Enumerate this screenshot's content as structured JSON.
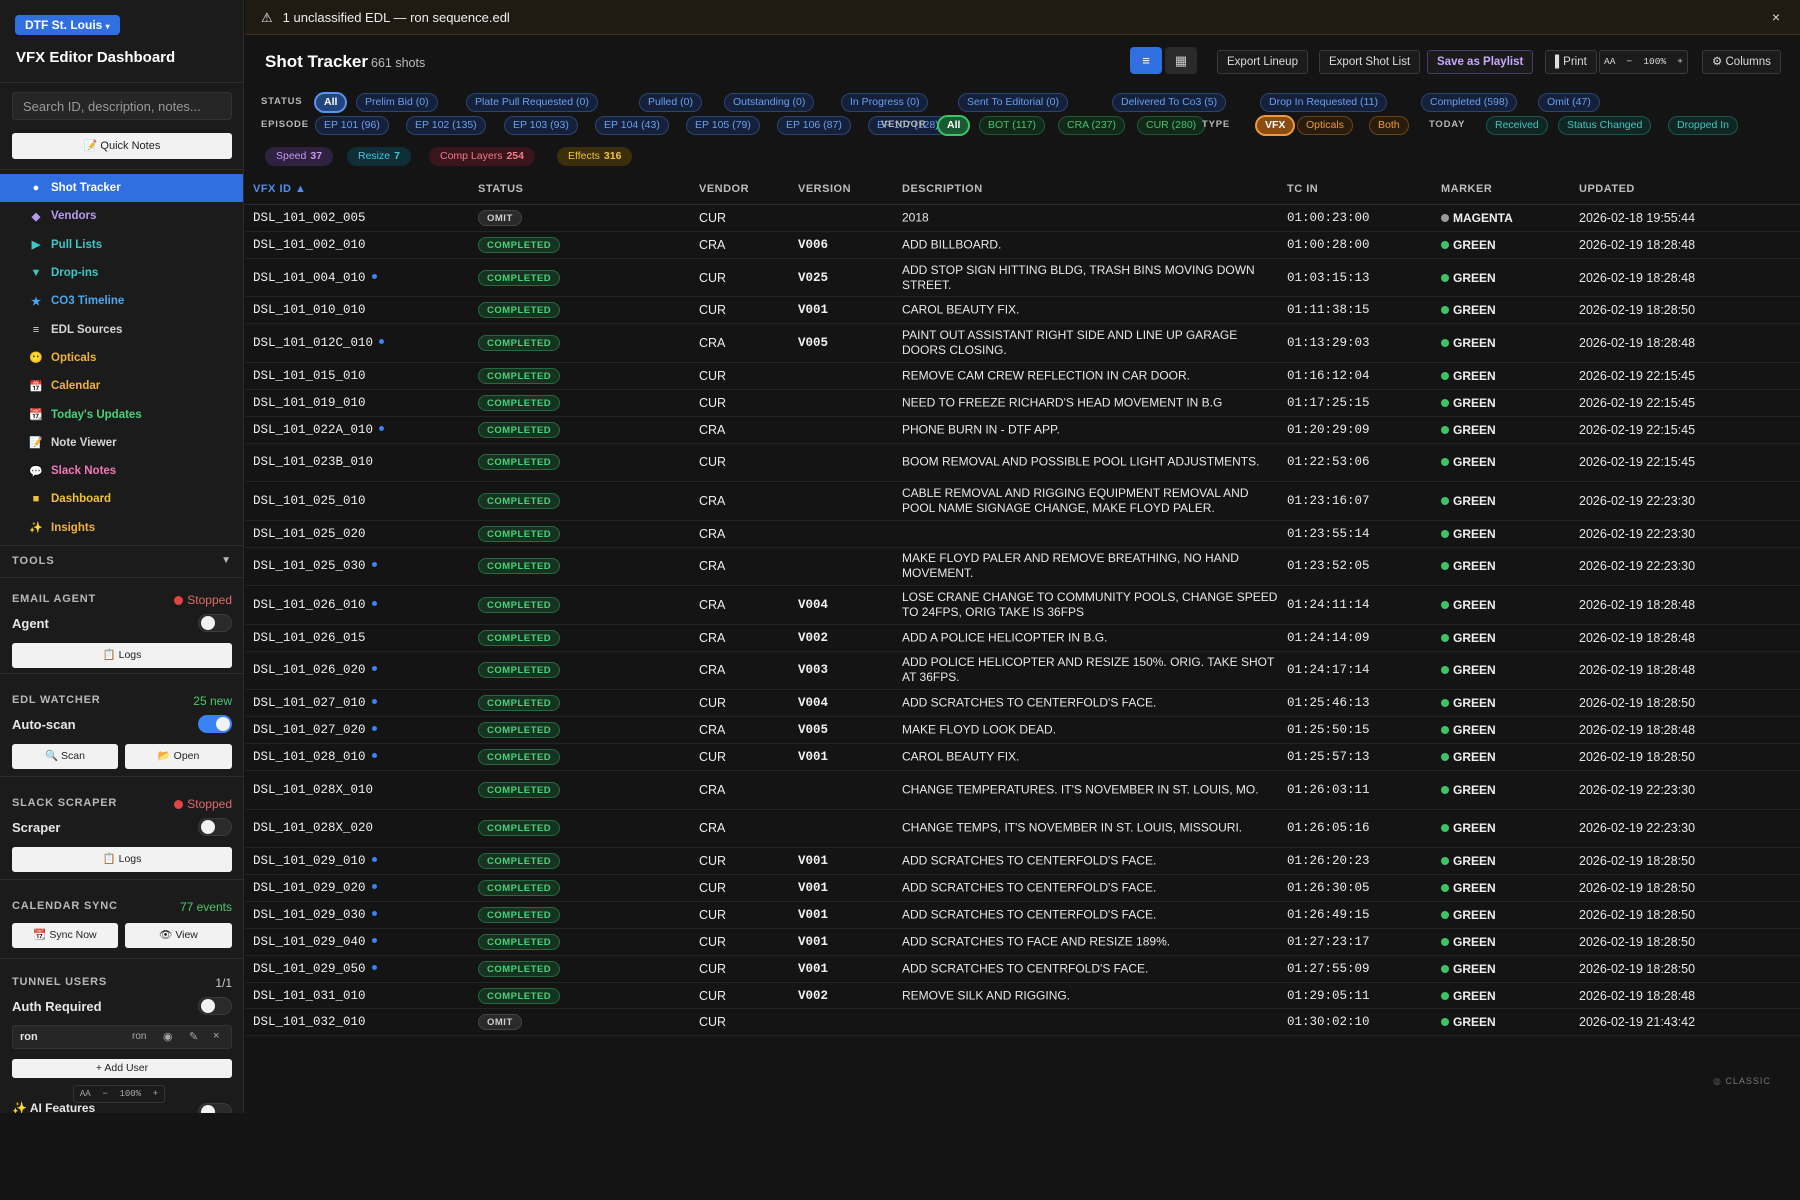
{
  "sidebar": {
    "site_badge": "DTF St. Louis",
    "app_title": "VFX Editor Dashboard",
    "search_placeholder": "Search ID, description, notes...",
    "quick_notes": "📝 Quick Notes",
    "nav": [
      {
        "label": "Shot Tracker",
        "icon": "●",
        "color": "#ffffff",
        "active": true
      },
      {
        "label": "Vendors",
        "icon": "◆",
        "color": "#b89af0",
        "active": false
      },
      {
        "label": "Pull Lists",
        "icon": "▶",
        "color": "#3ec7c7",
        "active": false
      },
      {
        "label": "Drop-ins",
        "icon": "▼",
        "color": "#3ec7c7",
        "active": false
      },
      {
        "label": "CO3 Timeline",
        "icon": "★",
        "color": "#4aa8f0",
        "active": false
      },
      {
        "label": "EDL Sources",
        "icon": "≡",
        "color": "#d6d6d6",
        "active": false
      },
      {
        "label": "Opticals",
        "icon": "😶",
        "color": "#f0b23c",
        "active": false
      },
      {
        "label": "Calendar",
        "icon": "📅",
        "color": "#f0b23c",
        "active": false
      },
      {
        "label": "Today's Updates",
        "icon": "📆",
        "color": "#4ad07a",
        "active": false
      },
      {
        "label": "Note Viewer",
        "icon": "📝",
        "color": "#d6d6d6",
        "active": false
      },
      {
        "label": "Slack Notes",
        "icon": "💬",
        "color": "#f07ab8",
        "active": false
      },
      {
        "label": "Dashboard",
        "icon": "■",
        "color": "#f0c23c",
        "active": false
      },
      {
        "label": "Insights",
        "icon": "✨",
        "color": "#f0b23c",
        "active": false
      }
    ],
    "tools_label": "TOOLS",
    "email_agent": {
      "title": "EMAIL AGENT",
      "status": "Stopped",
      "row_label": "Agent",
      "logs_btn": "📋 Logs"
    },
    "edl_watcher": {
      "title": "EDL WATCHER",
      "status": "25 new",
      "row_label": "Auto-scan",
      "scan_btn": "🔍 Scan",
      "open_btn": "📂 Open"
    },
    "slack_scraper": {
      "title": "SLACK SCRAPER",
      "status": "Stopped",
      "row_label": "Scraper",
      "logs_btn": "📋 Logs"
    },
    "calendar_sync": {
      "title": "CALENDAR SYNC",
      "status": "77 events",
      "sync_btn": "📆 Sync Now",
      "view_btn": "👁 View"
    },
    "tunnel_users": {
      "title": "TUNNEL USERS",
      "count": "1/1",
      "row_label": "Auth Required",
      "user_name": "ron",
      "user_value": "ron",
      "add_user_btn": "+ Add User"
    },
    "zoom": {
      "aa": "AA",
      "minus": "−",
      "value": "100%",
      "plus": "+"
    },
    "ai_features": "AI Features"
  },
  "banner": {
    "text": "1 unclassified EDL — ron sequence.edl",
    "close": "×"
  },
  "header": {
    "title": "Shot Tracker",
    "count": "661 shots",
    "list_view_icon": "≡",
    "grid_view_icon": "▦",
    "export_lineup": "Export Lineup",
    "export_shot_list": "Export Shot List",
    "save_playlist": "Save as Playlist",
    "print": "▌Print",
    "zoom": {
      "aa": "AA",
      "minus": "−",
      "value": "100%",
      "plus": "+"
    },
    "columns": "⚙ Columns"
  },
  "filters": {
    "status_label": "STATUS",
    "status": [
      "All",
      "Prelim Bid (0)",
      "Plate Pull Requested (0)",
      "Pulled (0)",
      "Outstanding (0)",
      "In Progress (0)",
      "Sent To Editorial (0)",
      "Delivered To Co3 (5)",
      "Drop In Requested (11)",
      "Completed (598)",
      "Omit (47)"
    ],
    "episode_label": "EPISODE",
    "episode": [
      "EP 101 (96)",
      "EP 102 (135)",
      "EP 103 (93)",
      "EP 104 (43)",
      "EP 105 (79)",
      "EP 106 (87)",
      "EP 107 (128)"
    ],
    "vendor_label": "VENDOR",
    "vendor": [
      "All",
      "BOT (117)",
      "CRA (237)",
      "CUR (280)"
    ],
    "type_label": "TYPE",
    "type": [
      "VFX",
      "Opticals",
      "Both"
    ],
    "today_label": "TODAY",
    "today": [
      "Received",
      "Status Changed",
      "Dropped In"
    ],
    "tags": [
      {
        "label": "Speed",
        "count": "37",
        "fg": "#c89af0",
        "bg": "#2e2142"
      },
      {
        "label": "Resize",
        "count": "7",
        "fg": "#3ec7e0",
        "bg": "#0f2e36"
      },
      {
        "label": "Comp Layers",
        "count": "254",
        "fg": "#f07a8a",
        "bg": "#3a161c"
      },
      {
        "label": "Effects",
        "count": "316",
        "fg": "#f0c23c",
        "bg": "#3a2e0c"
      }
    ]
  },
  "table": {
    "headers": [
      "VFX ID ▲",
      "STATUS",
      "VENDOR",
      "VERSION",
      "DESCRIPTION",
      "TC IN",
      "MARKER",
      "UPDATED"
    ],
    "rows": [
      {
        "id": "DSL_101_002_005",
        "dot": false,
        "status": "OMIT",
        "vendor": "CUR",
        "version": "",
        "desc": "2018",
        "tc": "01:00:23:00",
        "marker": "MAGENTA",
        "marker_color": "#9a9a9a",
        "updated": "2026-02-18 19:55:44"
      },
      {
        "id": "DSL_101_002_010",
        "dot": false,
        "status": "COMPLETED",
        "vendor": "CRA",
        "version": "V006",
        "desc": "ADD BILLBOARD.",
        "tc": "01:00:28:00",
        "marker": "GREEN",
        "marker_color": "#3dc467",
        "updated": "2026-02-19 18:28:48"
      },
      {
        "id": "DSL_101_004_010",
        "dot": true,
        "status": "COMPLETED",
        "vendor": "CUR",
        "version": "V025",
        "desc": "ADD STOP SIGN HITTING BLDG, TRASH BINS MOVING DOWN STREET.",
        "tc": "01:03:15:13",
        "marker": "GREEN",
        "marker_color": "#3dc467",
        "updated": "2026-02-19 18:28:48"
      },
      {
        "id": "DSL_101_010_010",
        "dot": false,
        "status": "COMPLETED",
        "vendor": "CUR",
        "version": "V001",
        "desc": "CAROL BEAUTY FIX.",
        "tc": "01:11:38:15",
        "marker": "GREEN",
        "marker_color": "#3dc467",
        "updated": "2026-02-19 18:28:50"
      },
      {
        "id": "DSL_101_012C_010",
        "dot": true,
        "status": "COMPLETED",
        "vendor": "CRA",
        "version": "V005",
        "desc": "PAINT OUT ASSISTANT RIGHT SIDE AND LINE UP GARAGE DOORS CLOSING.",
        "tc": "01:13:29:03",
        "marker": "GREEN",
        "marker_color": "#3dc467",
        "updated": "2026-02-19 18:28:48"
      },
      {
        "id": "DSL_101_015_010",
        "dot": false,
        "status": "COMPLETED",
        "vendor": "CUR",
        "version": "",
        "desc": "REMOVE CAM CREW REFLECTION IN CAR DOOR.",
        "tc": "01:16:12:04",
        "marker": "GREEN",
        "marker_color": "#3dc467",
        "updated": "2026-02-19 22:15:45"
      },
      {
        "id": "DSL_101_019_010",
        "dot": false,
        "status": "COMPLETED",
        "vendor": "CUR",
        "version": "",
        "desc": "NEED TO FREEZE RICHARD'S HEAD MOVEMENT IN B.G",
        "tc": "01:17:25:15",
        "marker": "GREEN",
        "marker_color": "#3dc467",
        "updated": "2026-02-19 22:15:45"
      },
      {
        "id": "DSL_101_022A_010",
        "dot": true,
        "status": "COMPLETED",
        "vendor": "CRA",
        "version": "",
        "desc": "PHONE BURN IN - DTF APP.",
        "tc": "01:20:29:09",
        "marker": "GREEN",
        "marker_color": "#3dc467",
        "updated": "2026-02-19 22:15:45"
      },
      {
        "id": "DSL_101_023B_010",
        "dot": false,
        "status": "COMPLETED",
        "vendor": "CUR",
        "version": "",
        "desc": "BOOM REMOVAL AND POSSIBLE POOL LIGHT ADJUSTMENTS.",
        "tc": "01:22:53:06",
        "marker": "GREEN",
        "marker_color": "#3dc467",
        "updated": "2026-02-19 22:15:45"
      },
      {
        "id": "DSL_101_025_010",
        "dot": false,
        "status": "COMPLETED",
        "vendor": "CRA",
        "version": "",
        "desc": "CABLE REMOVAL AND RIGGING EQUIPMENT REMOVAL AND POOL NAME SIGNAGE CHANGE, MAKE FLOYD PALER.",
        "tc": "01:23:16:07",
        "marker": "GREEN",
        "marker_color": "#3dc467",
        "updated": "2026-02-19 22:23:30"
      },
      {
        "id": "DSL_101_025_020",
        "dot": false,
        "status": "COMPLETED",
        "vendor": "CRA",
        "version": "",
        "desc": "",
        "tc": "01:23:55:14",
        "marker": "GREEN",
        "marker_color": "#3dc467",
        "updated": "2026-02-19 22:23:30"
      },
      {
        "id": "DSL_101_025_030",
        "dot": true,
        "status": "COMPLETED",
        "vendor": "CRA",
        "version": "",
        "desc": "MAKE FLOYD PALER AND REMOVE BREATHING, NO HAND MOVEMENT.",
        "tc": "01:23:52:05",
        "marker": "GREEN",
        "marker_color": "#3dc467",
        "updated": "2026-02-19 22:23:30"
      },
      {
        "id": "DSL_101_026_010",
        "dot": true,
        "status": "COMPLETED",
        "vendor": "CRA",
        "version": "V004",
        "desc": "LOSE CRANE CHANGE TO COMMUNITY POOLS, CHANGE SPEED TO 24FPS, ORIG TAKE IS 36FPS",
        "tc": "01:24:11:14",
        "marker": "GREEN",
        "marker_color": "#3dc467",
        "updated": "2026-02-19 18:28:48"
      },
      {
        "id": "DSL_101_026_015",
        "dot": false,
        "status": "COMPLETED",
        "vendor": "CRA",
        "version": "V002",
        "desc": "ADD A POLICE HELICOPTER IN B.G.",
        "tc": "01:24:14:09",
        "marker": "GREEN",
        "marker_color": "#3dc467",
        "updated": "2026-02-19 18:28:48"
      },
      {
        "id": "DSL_101_026_020",
        "dot": true,
        "status": "COMPLETED",
        "vendor": "CRA",
        "version": "V003",
        "desc": "ADD POLICE HELICOPTER AND RESIZE 150%. ORIG. TAKE SHOT AT 36FPS.",
        "tc": "01:24:17:14",
        "marker": "GREEN",
        "marker_color": "#3dc467",
        "updated": "2026-02-19 18:28:48"
      },
      {
        "id": "DSL_101_027_010",
        "dot": true,
        "status": "COMPLETED",
        "vendor": "CUR",
        "version": "V004",
        "desc": "ADD SCRATCHES TO CENTERFOLD'S FACE.",
        "tc": "01:25:46:13",
        "marker": "GREEN",
        "marker_color": "#3dc467",
        "updated": "2026-02-19 18:28:50"
      },
      {
        "id": "DSL_101_027_020",
        "dot": true,
        "status": "COMPLETED",
        "vendor": "CRA",
        "version": "V005",
        "desc": "MAKE FLOYD LOOK DEAD.",
        "tc": "01:25:50:15",
        "marker": "GREEN",
        "marker_color": "#3dc467",
        "updated": "2026-02-19 18:28:48"
      },
      {
        "id": "DSL_101_028_010",
        "dot": true,
        "status": "COMPLETED",
        "vendor": "CUR",
        "version": "V001",
        "desc": "CAROL BEAUTY FIX.",
        "tc": "01:25:57:13",
        "marker": "GREEN",
        "marker_color": "#3dc467",
        "updated": "2026-02-19 18:28:50"
      },
      {
        "id": "DSL_101_028X_010",
        "dot": false,
        "status": "COMPLETED",
        "vendor": "CRA",
        "version": "",
        "desc": "CHANGE TEMPERATURES. IT'S NOVEMBER IN ST. LOUIS, MO.",
        "tc": "01:26:03:11",
        "marker": "GREEN",
        "marker_color": "#3dc467",
        "updated": "2026-02-19 22:23:30"
      },
      {
        "id": "DSL_101_028X_020",
        "dot": false,
        "status": "COMPLETED",
        "vendor": "CRA",
        "version": "",
        "desc": "CHANGE TEMPS, IT'S NOVEMBER IN ST. LOUIS, MISSOURI.",
        "tc": "01:26:05:16",
        "marker": "GREEN",
        "marker_color": "#3dc467",
        "updated": "2026-02-19 22:23:30"
      },
      {
        "id": "DSL_101_029_010",
        "dot": true,
        "status": "COMPLETED",
        "vendor": "CUR",
        "version": "V001",
        "desc": "ADD SCRATCHES TO CENTERFOLD'S FACE.",
        "tc": "01:26:20:23",
        "marker": "GREEN",
        "marker_color": "#3dc467",
        "updated": "2026-02-19 18:28:50"
      },
      {
        "id": "DSL_101_029_020",
        "dot": true,
        "status": "COMPLETED",
        "vendor": "CUR",
        "version": "V001",
        "desc": "ADD SCRATCHES TO CENTERFOLD'S FACE.",
        "tc": "01:26:30:05",
        "marker": "GREEN",
        "marker_color": "#3dc467",
        "updated": "2026-02-19 18:28:50"
      },
      {
        "id": "DSL_101_029_030",
        "dot": true,
        "status": "COMPLETED",
        "vendor": "CUR",
        "version": "V001",
        "desc": "ADD SCRATCHES TO CENTERFOLD'S FACE.",
        "tc": "01:26:49:15",
        "marker": "GREEN",
        "marker_color": "#3dc467",
        "updated": "2026-02-19 18:28:50"
      },
      {
        "id": "DSL_101_029_040",
        "dot": true,
        "status": "COMPLETED",
        "vendor": "CUR",
        "version": "V001",
        "desc": "ADD SCRATCHES TO FACE AND RESIZE 189%.",
        "tc": "01:27:23:17",
        "marker": "GREEN",
        "marker_color": "#3dc467",
        "updated": "2026-02-19 18:28:50"
      },
      {
        "id": "DSL_101_029_050",
        "dot": true,
        "status": "COMPLETED",
        "vendor": "CUR",
        "version": "V001",
        "desc": "ADD SCRATCHES TO CENTRFOLD'S FACE.",
        "tc": "01:27:55:09",
        "marker": "GREEN",
        "marker_color": "#3dc467",
        "updated": "2026-02-19 18:28:50"
      },
      {
        "id": "DSL_101_031_010",
        "dot": false,
        "status": "COMPLETED",
        "vendor": "CUR",
        "version": "V002",
        "desc": "REMOVE SILK AND RIGGING.",
        "tc": "01:29:05:11",
        "marker": "GREEN",
        "marker_color": "#3dc467",
        "updated": "2026-02-19 18:28:48"
      },
      {
        "id": "DSL_101_032_010",
        "dot": false,
        "status": "OMIT",
        "vendor": "CUR",
        "version": "",
        "desc": "",
        "tc": "01:30:02:10",
        "marker": "GREEN",
        "marker_color": "#3dc467",
        "updated": "2026-02-19 21:43:42"
      }
    ]
  },
  "footer_badge": "CLASSIC"
}
